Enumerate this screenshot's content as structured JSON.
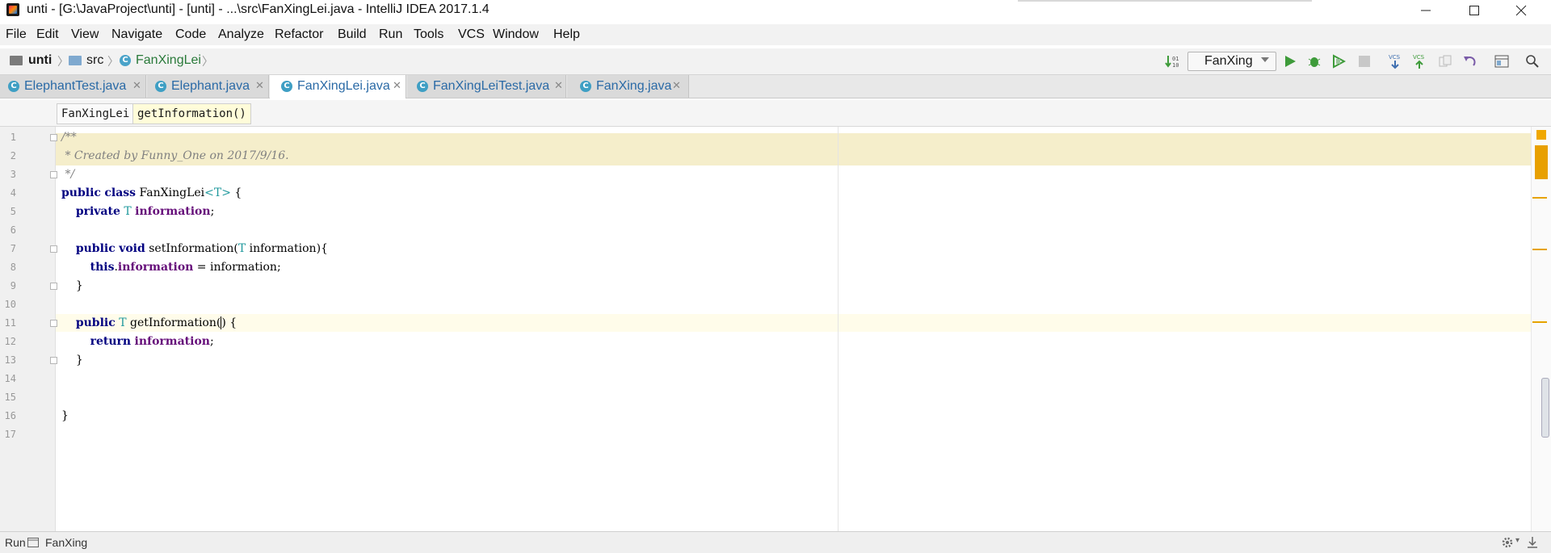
{
  "window": {
    "title": "unti - [G:\\JavaProject\\unti] - [unti] - ...\\src\\FanXingLei.java - IntelliJ IDEA 2017.1.4",
    "controls": [
      "minimize",
      "maximize",
      "close"
    ]
  },
  "menu": [
    "File",
    "Edit",
    "View",
    "Navigate",
    "Code",
    "Analyze",
    "Refactor",
    "Build",
    "Run",
    "Tools",
    "VCS",
    "Window",
    "Help"
  ],
  "navbar": {
    "breadcrumb": [
      "unti",
      "src",
      "FanXingLei"
    ],
    "run_config": "FanXing"
  },
  "tabs": [
    {
      "label": "ElephantTest.java",
      "active": false
    },
    {
      "label": "Elephant.java",
      "active": false
    },
    {
      "label": "FanXingLei.java",
      "active": true
    },
    {
      "label": "FanXingLeiTest.java",
      "active": false
    },
    {
      "label": "FanXing.java",
      "active": false
    }
  ],
  "structure_crumbs": [
    "FanXingLei",
    "getInformation()"
  ],
  "code": {
    "line_numbers": [
      "1",
      "2",
      "3",
      "4",
      "5",
      "6",
      "7",
      "8",
      "9",
      "10",
      "11",
      "12",
      "13",
      "14",
      "15",
      "16",
      "17"
    ],
    "comment": {
      "l1": "/**",
      "l2": " * Created by Funny_One on 2017/9/16.",
      "l3": " */"
    },
    "l4": {
      "public": "public",
      "class": "class",
      "name": "FanXingLei",
      "tp": "<T>",
      "brace": " {"
    },
    "l5": {
      "private": "private",
      "type": "T",
      "field": "information",
      "end": ";"
    },
    "l7": {
      "public": "public",
      "void": "void",
      "method": "setInformation(",
      "type": "T",
      "param": " information){"
    },
    "l8": {
      "this": "this",
      "dot": ".",
      "field": "information",
      "rest": " = information;"
    },
    "l9": "}",
    "l11": {
      "public": "public",
      "type": "T",
      "method": "getInformation(",
      "close": ") {"
    },
    "l12": {
      "return": "return",
      "field": "information",
      "end": ";"
    },
    "l13": "}",
    "l16": "}"
  },
  "status": {
    "run_label": "Run",
    "run_config": "FanXing"
  },
  "colors": {
    "keyword": "#000080",
    "field": "#660e7a",
    "comment": "#808080",
    "type_param": "#20999d",
    "run_green": "#3e9b3a"
  }
}
